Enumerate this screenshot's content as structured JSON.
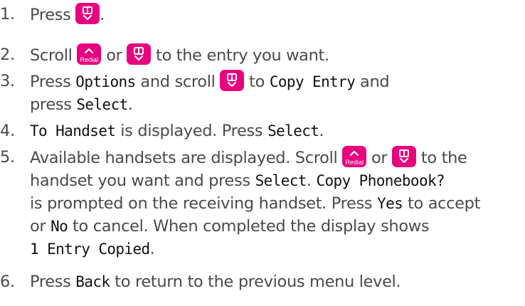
{
  "steps": [
    {
      "number": "1.",
      "parts": {
        "t1": "Press ",
        "t2": "."
      },
      "icons": [
        "phonebook-down-key"
      ]
    },
    {
      "number": "2.",
      "parts": {
        "t1": "Scroll ",
        "t2": " or ",
        "t3": " to the entry you want."
      },
      "icons": [
        "redial-up-key",
        "phonebook-down-key"
      ]
    },
    {
      "number": "3.",
      "parts": {
        "t1": "Press ",
        "lcd1": "Options",
        "t2": " and scroll ",
        "t3": " to ",
        "lcd2": "Copy Entry",
        "t4": " and",
        "t5": "press ",
        "lcd3": "Select",
        "t6": "."
      },
      "icons": [
        "phonebook-down-key"
      ]
    },
    {
      "number": "4.",
      "parts": {
        "lcd1": "To Handset",
        "t1": " is displayed. Press ",
        "lcd2": "Select",
        "t2": "."
      }
    },
    {
      "number": "5.",
      "parts": {
        "t1": "Available handsets are displayed. Scroll ",
        "t2": " or ",
        "t3": " to the",
        "t4": "handset you want and press ",
        "lcd1": "Select",
        "t5": ". ",
        "lcd2": "Copy Phonebook?",
        "t6": "is prompted on the receiving handset. Press ",
        "lcd3": "Yes",
        "t7": " to accept",
        "t8": "or ",
        "lcd4": "No",
        "t9": " to cancel. When completed the display shows",
        "lcd5": "1 Entry Copied",
        "t10": "."
      },
      "icons": [
        "redial-up-key",
        "phonebook-down-key"
      ]
    },
    {
      "number": "6.",
      "parts": {
        "t1": "Press ",
        "lcd1": "Back",
        "t2": " to return to the previous menu level."
      }
    }
  ],
  "keys": {
    "redial_label": "Redial"
  },
  "colors": {
    "key_magenta": "#e8007d",
    "body_text": "#4a4a4a",
    "lcd_text": "#111111",
    "heading_blue": "#1f4fa0"
  }
}
